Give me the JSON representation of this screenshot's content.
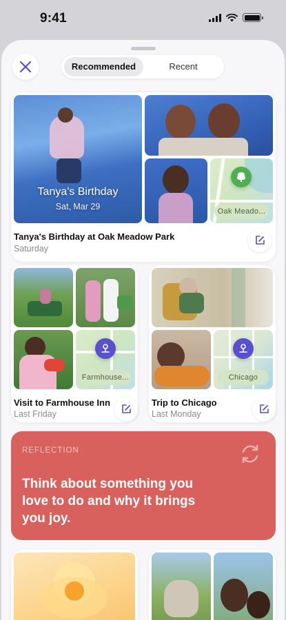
{
  "status_bar": {
    "time": "9:41"
  },
  "tabs": [
    {
      "label": "Recommended",
      "selected": true
    },
    {
      "label": "Recent",
      "selected": false
    }
  ],
  "cards": {
    "birthday": {
      "overlay_title": "Tanya's Birthday",
      "overlay_date": "Sat, Mar 29",
      "map_label": "Oak Meado...",
      "title": "Tanya's Birthday at Oak Meadow Park",
      "subtitle": "Saturday"
    },
    "farmhouse": {
      "map_label": "Farmhouse...",
      "title": "Visit to Farmhouse Inn",
      "subtitle": "Last Friday"
    },
    "chicago": {
      "map_label": "Chicago",
      "title": "Trip to Chicago",
      "subtitle": "Last Monday"
    }
  },
  "reflection": {
    "kicker": "REFLECTION",
    "prompt": "Think about something you love to do and why it brings you joy."
  },
  "colors": {
    "accent": "#5a4fcf",
    "reflection_bg": "#d8615e",
    "park_pin": "#4caf50",
    "location_pin": "#5a4fcf"
  },
  "icons": [
    "close-icon",
    "edit-icon",
    "tree-pin-icon",
    "location-pin-icon",
    "refresh-icon"
  ]
}
